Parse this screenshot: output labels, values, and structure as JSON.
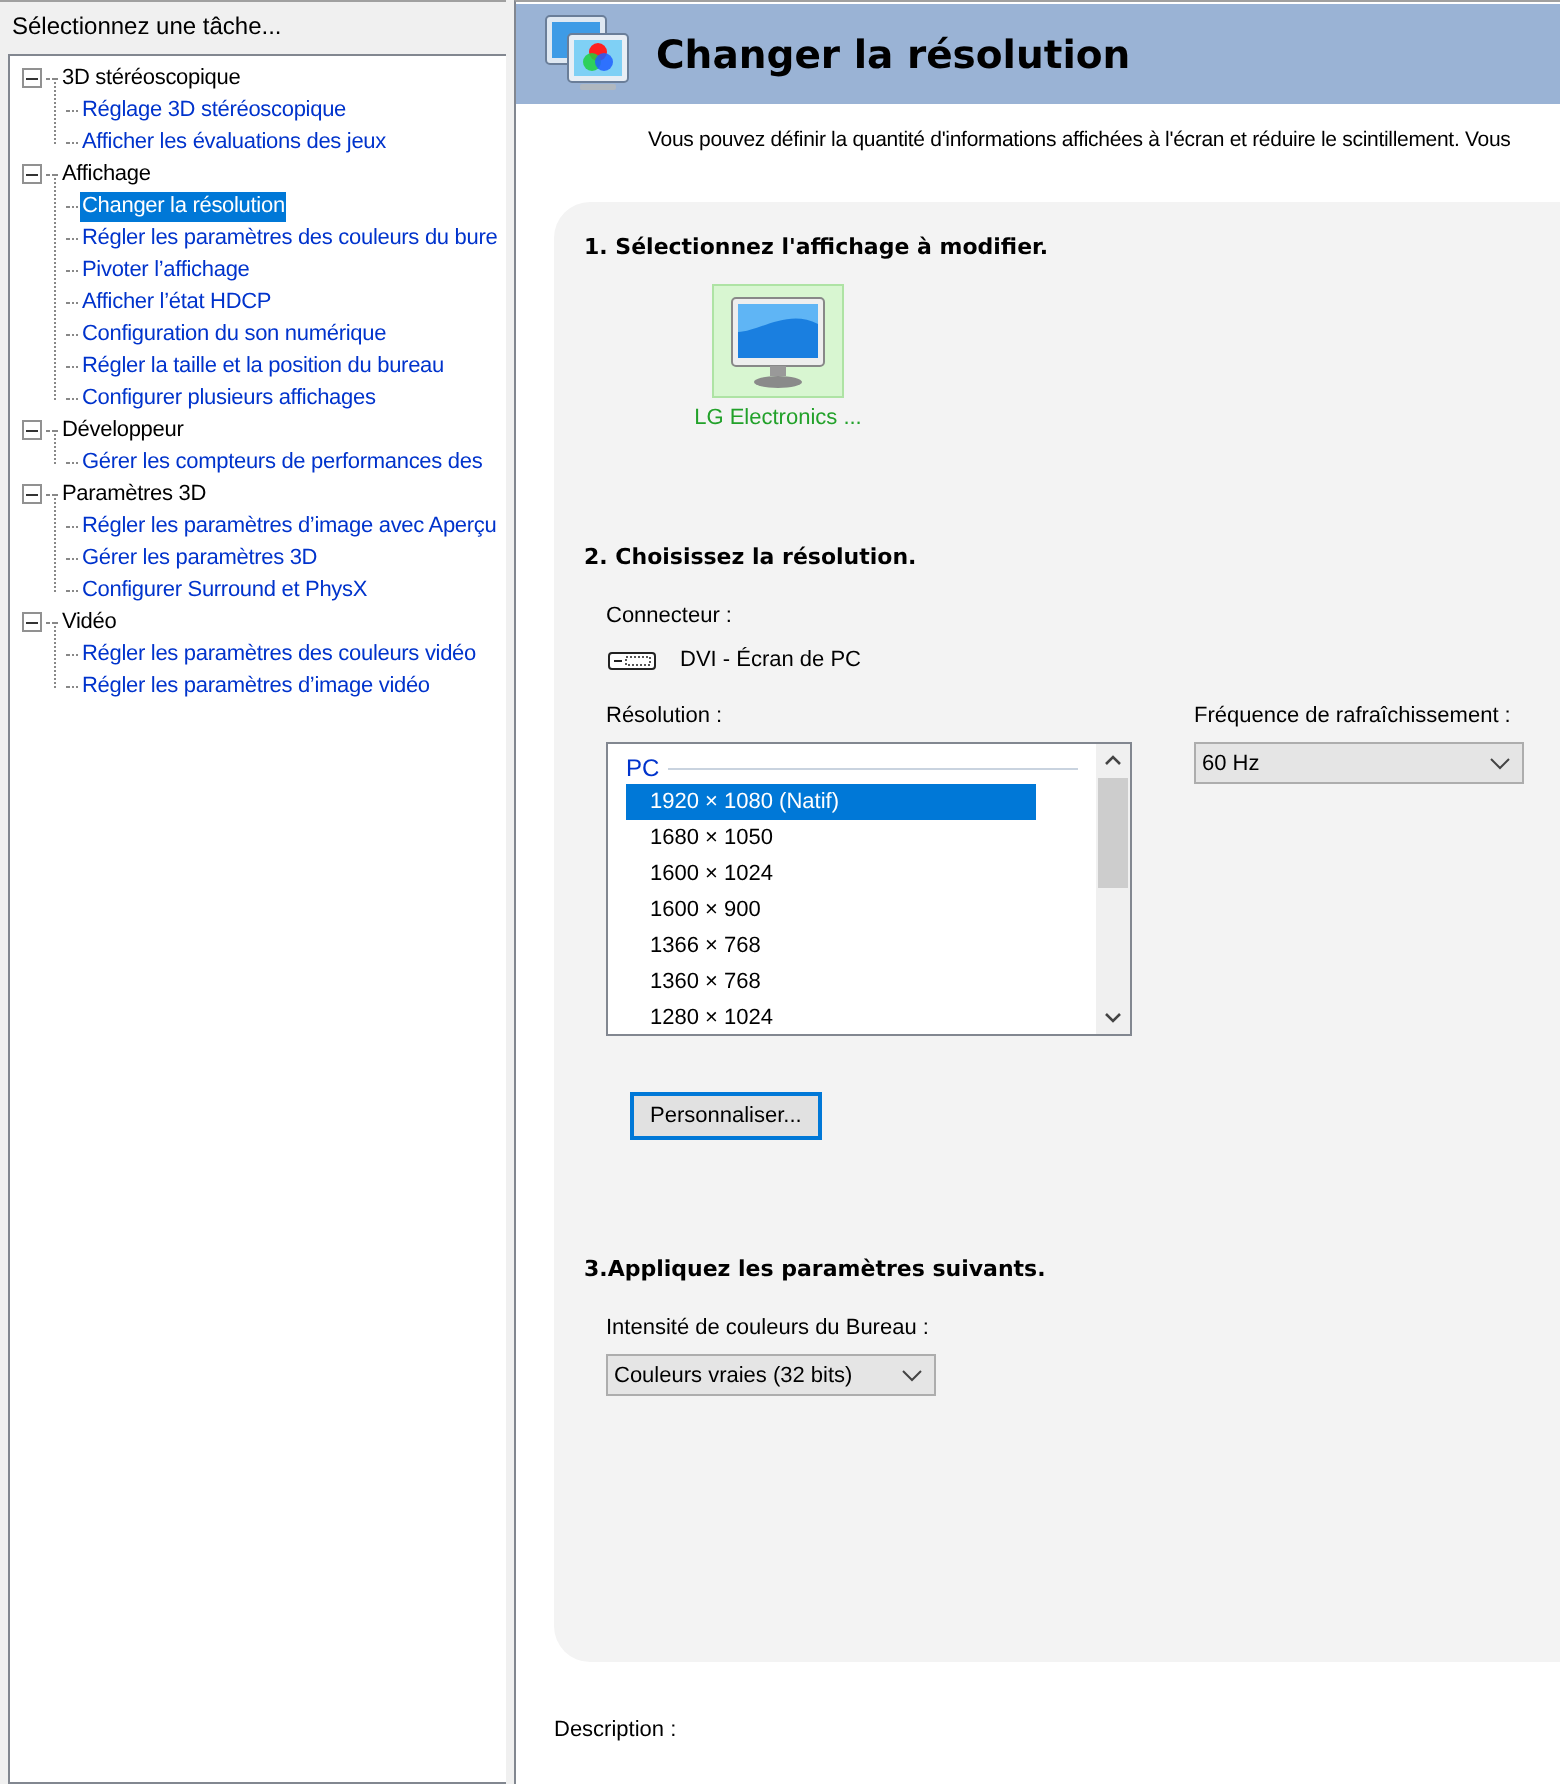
{
  "sidebar": {
    "title": "Sélectionnez une tâche...",
    "tree": [
      {
        "label": "3D stéréoscopique",
        "expanded": true,
        "selected": false,
        "children": [
          {
            "label": "Réglage 3D stéréoscopique",
            "selected": false
          },
          {
            "label": "Afficher les évaluations des jeux",
            "selected": false
          }
        ]
      },
      {
        "label": "Affichage",
        "expanded": true,
        "selected": false,
        "children": [
          {
            "label": "Changer la résolution",
            "selected": true
          },
          {
            "label": "Régler les paramètres des couleurs du bure",
            "selected": false
          },
          {
            "label": "Pivoter l’affichage",
            "selected": false
          },
          {
            "label": "Afficher l’état HDCP",
            "selected": false
          },
          {
            "label": "Configuration du son numérique",
            "selected": false
          },
          {
            "label": "Régler la taille et la position du bureau",
            "selected": false
          },
          {
            "label": "Configurer plusieurs affichages",
            "selected": false
          }
        ]
      },
      {
        "label": "Développeur",
        "expanded": true,
        "selected": false,
        "children": [
          {
            "label": "Gérer les compteurs de performances des",
            "selected": false
          }
        ]
      },
      {
        "label": "Paramètres 3D",
        "expanded": true,
        "selected": false,
        "children": [
          {
            "label": "Régler les paramètres d’image avec Aperçu",
            "selected": false
          },
          {
            "label": "Gérer les paramètres 3D",
            "selected": false
          },
          {
            "label": "Configurer Surround et PhysX",
            "selected": false
          }
        ]
      },
      {
        "label": "Vidéo",
        "expanded": true,
        "selected": false,
        "children": [
          {
            "label": "Régler les paramètres des couleurs vidéo",
            "selected": false
          },
          {
            "label": "Régler les paramètres d’image vidéo",
            "selected": false
          }
        ]
      }
    ]
  },
  "page": {
    "title": "Changer la résolution",
    "intro": "Vous pouvez définir la quantité d'informations affichées à l'écran et réduire le scintillement. Vous",
    "step1": {
      "heading": "1. Sélectionnez l'affichage à modifier.",
      "displays": [
        {
          "label": "LG Electronics ...",
          "selected": true
        }
      ]
    },
    "step2": {
      "heading": "2. Choisissez la résolution.",
      "connector_label": "Connecteur :",
      "connector": "DVI - Écran de PC",
      "resolution_label": "Résolution :",
      "resolution_group": "PC",
      "resolutions": [
        {
          "label": "1920 × 1080 (Natif)",
          "selected": true
        },
        {
          "label": "1680 × 1050",
          "selected": false
        },
        {
          "label": "1600 × 1024",
          "selected": false
        },
        {
          "label": "1600 × 900",
          "selected": false
        },
        {
          "label": "1366 × 768",
          "selected": false
        },
        {
          "label": "1360 × 768",
          "selected": false
        },
        {
          "label": "1280 × 1024",
          "selected": false
        }
      ],
      "refresh_label": "Fréquence de rafraîchissement :",
      "refresh": "60 Hz",
      "custom_button": "Personnaliser..."
    },
    "step3": {
      "heading": "3.Appliquez les paramètres suivants.",
      "depth_label": "Intensité de couleurs du Bureau :",
      "depth": "Couleurs vraies (32 bits)"
    },
    "description_label": "Description :"
  }
}
